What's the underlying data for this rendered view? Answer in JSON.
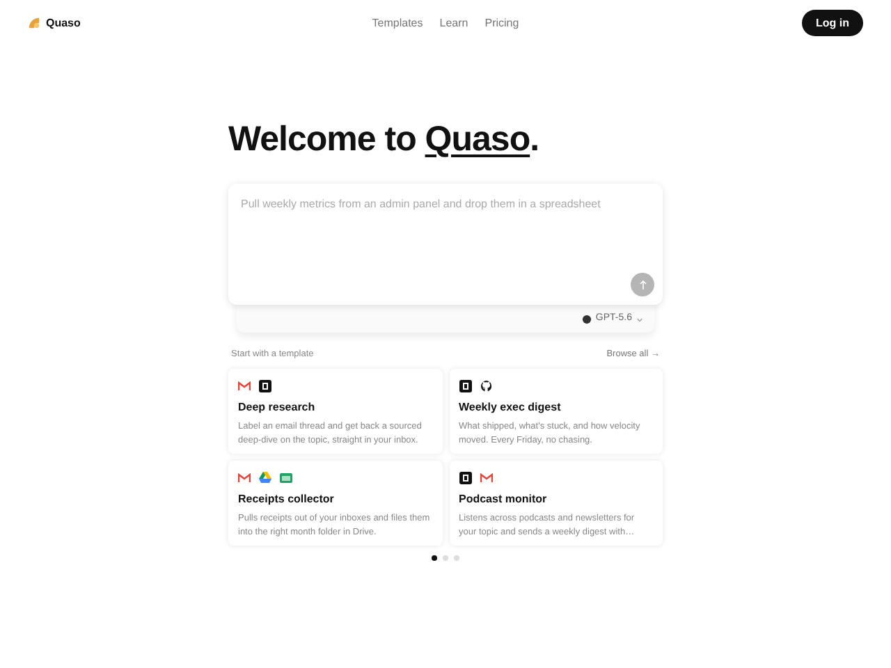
{
  "brand": {
    "name": "Quaso"
  },
  "nav": [
    {
      "label": "Templates"
    },
    {
      "label": "Learn"
    },
    {
      "label": "Pricing"
    }
  ],
  "login": "Log in",
  "heading": {
    "prefix": "Welcome to ",
    "brand": "Quaso",
    "suffix": "."
  },
  "prompt": {
    "placeholder": "Pull weekly metrics from an admin panel and drop them in a spreadsheet"
  },
  "model": "GPT-5.6",
  "templates_label": "Start with a template",
  "browse_all": "Browse all →",
  "templates": [
    {
      "title": "Deep research",
      "description": "Label an email thread and get back a sourced deep-dive on the topic, straight in your inbox.",
      "icons": [
        {
          "kind": "gmail"
        },
        {
          "kind": "notion"
        }
      ]
    },
    {
      "title": "Weekly exec digest",
      "description": "What shipped, what's stuck, and how velocity moved. Every Friday, no chasing.",
      "icons": [
        {
          "kind": "notion"
        },
        {
          "kind": "github"
        }
      ]
    },
    {
      "title": "Receipts collector",
      "description": "Pulls receipts out of your inboxes and files them into the right month folder in Drive.",
      "icons": [
        {
          "kind": "gmail"
        },
        {
          "kind": "drive"
        },
        {
          "kind": "sheets"
        }
      ]
    },
    {
      "title": "Podcast monitor",
      "description": "Listens across podcasts and newsletters for your topic and sends a weekly digest with…",
      "icons": [
        {
          "kind": "notion"
        },
        {
          "kind": "gmail"
        }
      ]
    }
  ],
  "pages": [
    {
      "selected": true
    },
    {
      "selected": false
    },
    {
      "selected": false
    }
  ]
}
